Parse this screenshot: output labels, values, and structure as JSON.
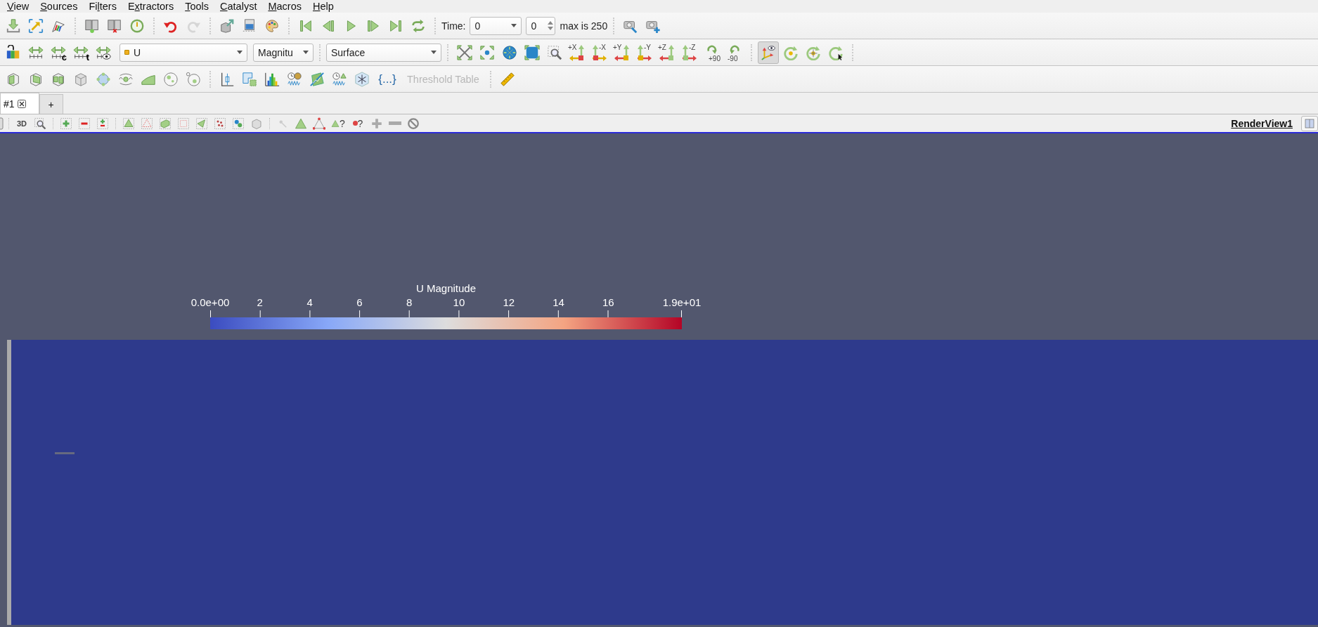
{
  "menu_bar": {
    "items": [
      {
        "accel": "V",
        "rest": "iew"
      },
      {
        "accel": "S",
        "rest": "ources"
      },
      {
        "lead": "Fi",
        "accel": "l",
        "rest": "ters"
      },
      {
        "lead": "E",
        "accel": "x",
        "rest": "tractors"
      },
      {
        "accel": "T",
        "rest": "ools"
      },
      {
        "accel": "C",
        "rest": "atalyst"
      },
      {
        "accel": "M",
        "rest": "acros"
      },
      {
        "accel": "H",
        "rest": "elp"
      }
    ]
  },
  "main_toolbar": {
    "redo_disabled": true,
    "time_label": "Time:",
    "time_value": "0",
    "timestep_value": "0",
    "max_text": "max is 250"
  },
  "display_toolbar": {
    "rescale_buttons": [
      {
        "kind": "plain"
      },
      {
        "kind": "mark",
        "mark": "c"
      },
      {
        "kind": "mark",
        "mark": "t"
      },
      {
        "kind": "eye"
      }
    ],
    "array_combo": "U",
    "component_combo": "Magnitu",
    "representation_combo": "Surface",
    "axis_buttons": [
      {
        "label": "+X"
      },
      {
        "label": "-X"
      },
      {
        "label": "+Y"
      },
      {
        "label": "-Y"
      },
      {
        "label": "+Z"
      },
      {
        "label": "-Z"
      }
    ],
    "rotate_buttons": [
      {
        "label": "+90"
      },
      {
        "label": "-90"
      }
    ],
    "interaction_buttons": [
      {
        "pressed": true
      },
      {
        "pressed": false
      },
      {
        "pressed": false
      },
      {
        "pressed": false
      }
    ]
  },
  "filters_toolbar": {
    "braces_button": "{...}",
    "threshold_table": {
      "label": "Threshold Table",
      "disabled": true
    }
  },
  "tabs": [
    {
      "label": "#1",
      "selected": true
    },
    {
      "label": "+",
      "selected": false
    }
  ],
  "view_toolbar": {
    "mode_button": "3D",
    "query_marks": [
      "?",
      "?"
    ],
    "view_name": "RenderView1"
  },
  "render_view": {
    "color_legend": {
      "title": "U Magnitude",
      "ticks": [
        "0.0e+00",
        "2",
        "4",
        "6",
        "8",
        "10",
        "12",
        "14",
        "16",
        "1.9e+01"
      ]
    }
  }
}
